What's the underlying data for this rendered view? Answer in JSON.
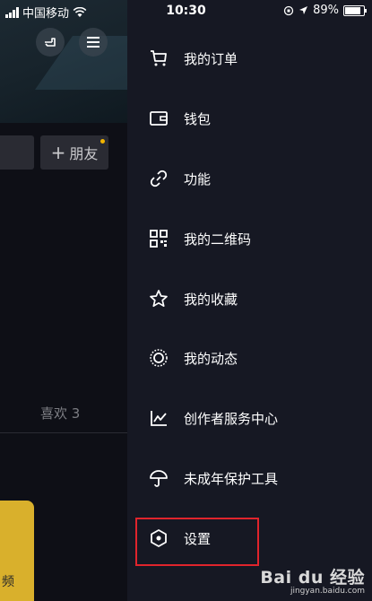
{
  "status_bar": {
    "carrier": "中国移动",
    "time": "10:30",
    "battery": "89%"
  },
  "profile": {
    "add_friend_label": "朋友",
    "likes_tab": "喜欢 3",
    "card_text": "频"
  },
  "menu": {
    "items": [
      {
        "label": "我的订单",
        "icon": "cart-icon"
      },
      {
        "label": "钱包",
        "icon": "wallet-icon"
      },
      {
        "label": "功能",
        "icon": "link-icon"
      },
      {
        "label": "我的二维码",
        "icon": "qr-code-icon"
      },
      {
        "label": "我的收藏",
        "icon": "star-icon"
      },
      {
        "label": "我的动态",
        "icon": "activity-ring-icon"
      },
      {
        "label": "创作者服务中心",
        "icon": "line-chart-icon"
      },
      {
        "label": "未成年保护工具",
        "icon": "umbrella-icon"
      },
      {
        "label": "设置",
        "icon": "hexagon-settings-icon"
      }
    ]
  },
  "watermark": {
    "brand": "Bai du 经验",
    "url": "jingyan.baidu.com"
  },
  "colors": {
    "background": "#161823",
    "highlight": "#e0242c",
    "accent_yellow": "#d9b02c"
  }
}
